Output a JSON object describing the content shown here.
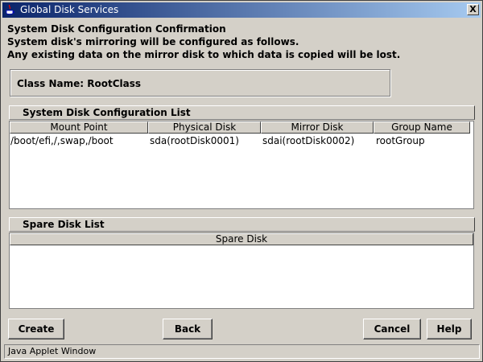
{
  "window": {
    "title": "Global Disk Services",
    "close_label": "X"
  },
  "header": {
    "line1": "System Disk Configuration Confirmation",
    "line2": "System disk's mirroring will be configured as follows.",
    "line3": "Any existing data on the mirror disk to which data is copied will be lost."
  },
  "class_box": {
    "label": "Class Name: RootClass"
  },
  "system_disk_list": {
    "title": "System Disk Configuration List",
    "columns": [
      "Mount Point",
      "Physical Disk",
      "Mirror Disk",
      "Group Name"
    ],
    "rows": [
      [
        "/boot/efi,/,swap,/boot",
        "sda(rootDisk0001)",
        "sdai(rootDisk0002)",
        "rootGroup"
      ]
    ]
  },
  "spare_disk_list": {
    "title": "Spare Disk List",
    "columns": [
      "Spare Disk"
    ],
    "rows": []
  },
  "buttons": {
    "create": "Create",
    "back": "Back",
    "cancel": "Cancel",
    "help": "Help"
  },
  "status_bar": {
    "text": "Java Applet Window"
  },
  "colors": {
    "titlebar_start": "#0a246a",
    "titlebar_end": "#a6caf0",
    "window_bg": "#d4d0c8"
  },
  "icons": {
    "app": "java-cup-icon",
    "close": "close-icon"
  }
}
